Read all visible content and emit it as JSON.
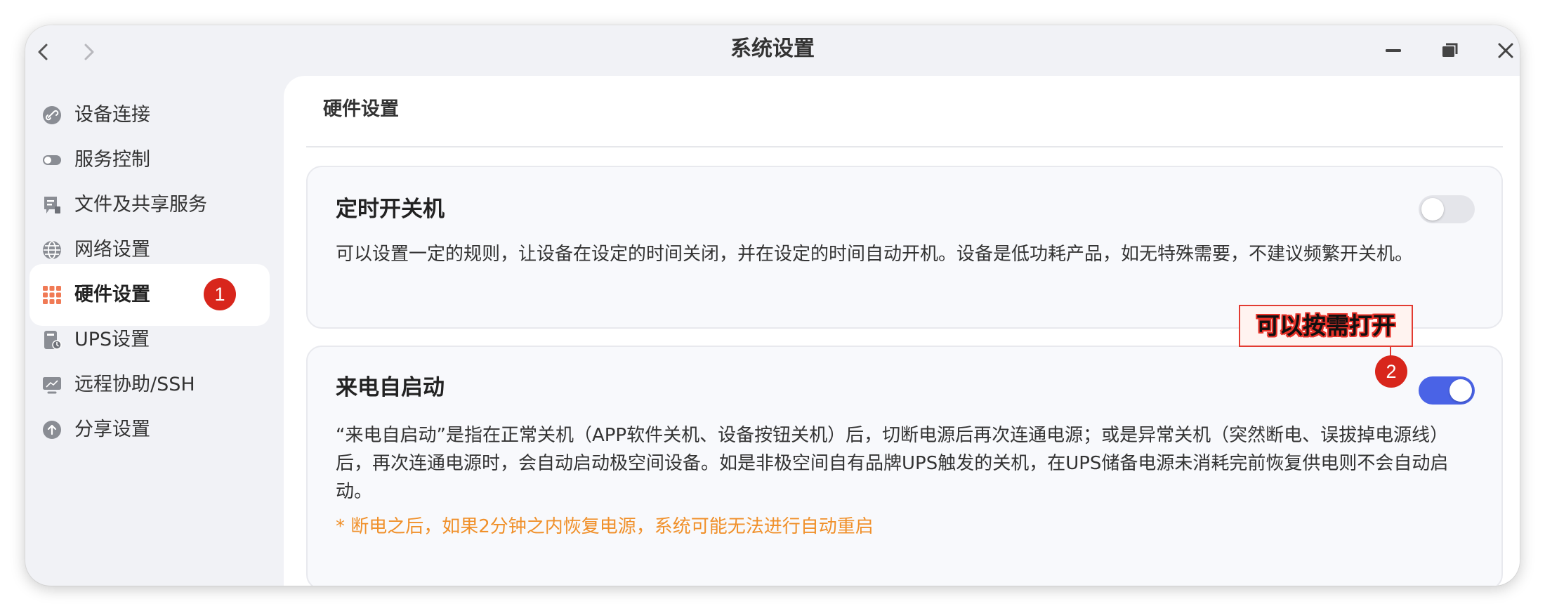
{
  "window": {
    "title": "系统设置"
  },
  "sidebar": {
    "items": [
      {
        "label": "设备连接",
        "icon": "link-icon"
      },
      {
        "label": "服务控制",
        "icon": "toggle-icon"
      },
      {
        "label": "文件及共享服务",
        "icon": "file-share-icon"
      },
      {
        "label": "网络设置",
        "icon": "globe-icon"
      },
      {
        "label": "硬件设置",
        "icon": "grid-icon",
        "active": true
      },
      {
        "label": "UPS设置",
        "icon": "ups-icon"
      },
      {
        "label": "远程协助/SSH",
        "icon": "monitor-icon"
      },
      {
        "label": "分享设置",
        "icon": "upload-icon"
      }
    ]
  },
  "main": {
    "section_title": "硬件设置",
    "cards": [
      {
        "title": "定时开关机",
        "description": "可以设置一定的规则，让设备在设定的时间关闭，并在设定的时间自动开机。设备是低功耗产品，如无特殊需要，不建议频繁开关机。",
        "toggle_on": false
      },
      {
        "title": "来电自启动",
        "description": "“来电自启动”是指在正常关机（APP软件关机、设备按钮关机）后，切断电源后再次连通电源；或是异常关机（突然断电、误拔掉电源线）后，再次连通电源时，会自动启动极空间设备。如是非极空间自有品牌UPS触发的关机，在UPS储备电源未消耗完前恢复供电则不会自动启动。",
        "warning": "* 断电之后，如果2分钟之内恢复电源，系统可能无法进行自动重启",
        "toggle_on": true
      }
    ]
  },
  "annotations": {
    "badge_1": "1",
    "badge_2": "2",
    "callout": "可以按需打开"
  },
  "colors": {
    "accent": "#4a63e6",
    "warning": "#f0902a",
    "annotation_red": "#d8261c"
  }
}
